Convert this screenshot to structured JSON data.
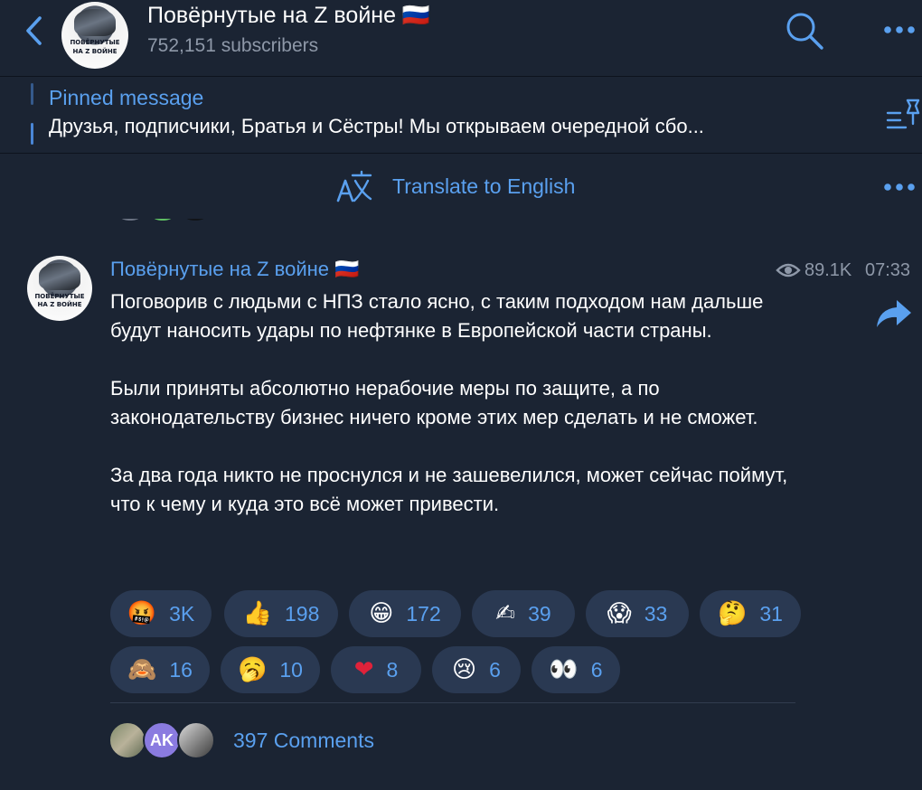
{
  "header": {
    "title": "Повёрнутые на Z войне 🇷🇺",
    "subscribers": "752,151 subscribers",
    "avatar_caption_line1": "ПОВЁРНУТЫЕ",
    "avatar_caption_line2": "НА Z ВОЙНЕ"
  },
  "pinned": {
    "label": "Pinned message",
    "text": "Друзья, подписчики, Братья и Сёстры! Мы открываем очередной сбо..."
  },
  "translate": {
    "label": "Translate to English"
  },
  "post": {
    "author": "Повёрнутые на Z войне 🇷🇺",
    "views": "89.1K",
    "time": "07:33",
    "paragraphs": [
      "Поговорив с людьми с НПЗ стало ясно, с таким подходом нам дальше будут наносить удары по нефтянке в Европейской части страны.",
      "Были приняты абсолютно нерабочие меры по защите, а по законодательству бизнес ничего кроме этих мер сделать и не сможет.",
      "За два года никто не проснулся и не зашевелился, может сейчас поймут, что к чему и куда это всё может привести."
    ],
    "reactions": [
      {
        "emoji": "🤬",
        "count": "3K"
      },
      {
        "emoji": "👍",
        "count": "198"
      },
      {
        "emoji": "😁",
        "count": "172"
      },
      {
        "emoji": "✍",
        "count": "39"
      },
      {
        "emoji": "😱",
        "count": "33"
      },
      {
        "emoji": "🤔",
        "count": "31"
      },
      {
        "emoji": "🙈",
        "count": "16"
      },
      {
        "emoji": "🥱",
        "count": "10"
      },
      {
        "emoji": "❤",
        "count": "8"
      },
      {
        "emoji": "😢",
        "count": "6"
      },
      {
        "emoji": "👀",
        "count": "6"
      }
    ],
    "comments": {
      "label": "397 Comments",
      "commenter_initials": "AK"
    }
  },
  "colors": {
    "background": "#1b2433",
    "accent": "#5aa0ef",
    "reaction_bg": "#2a3952",
    "secondary_text": "#8e98a8"
  }
}
